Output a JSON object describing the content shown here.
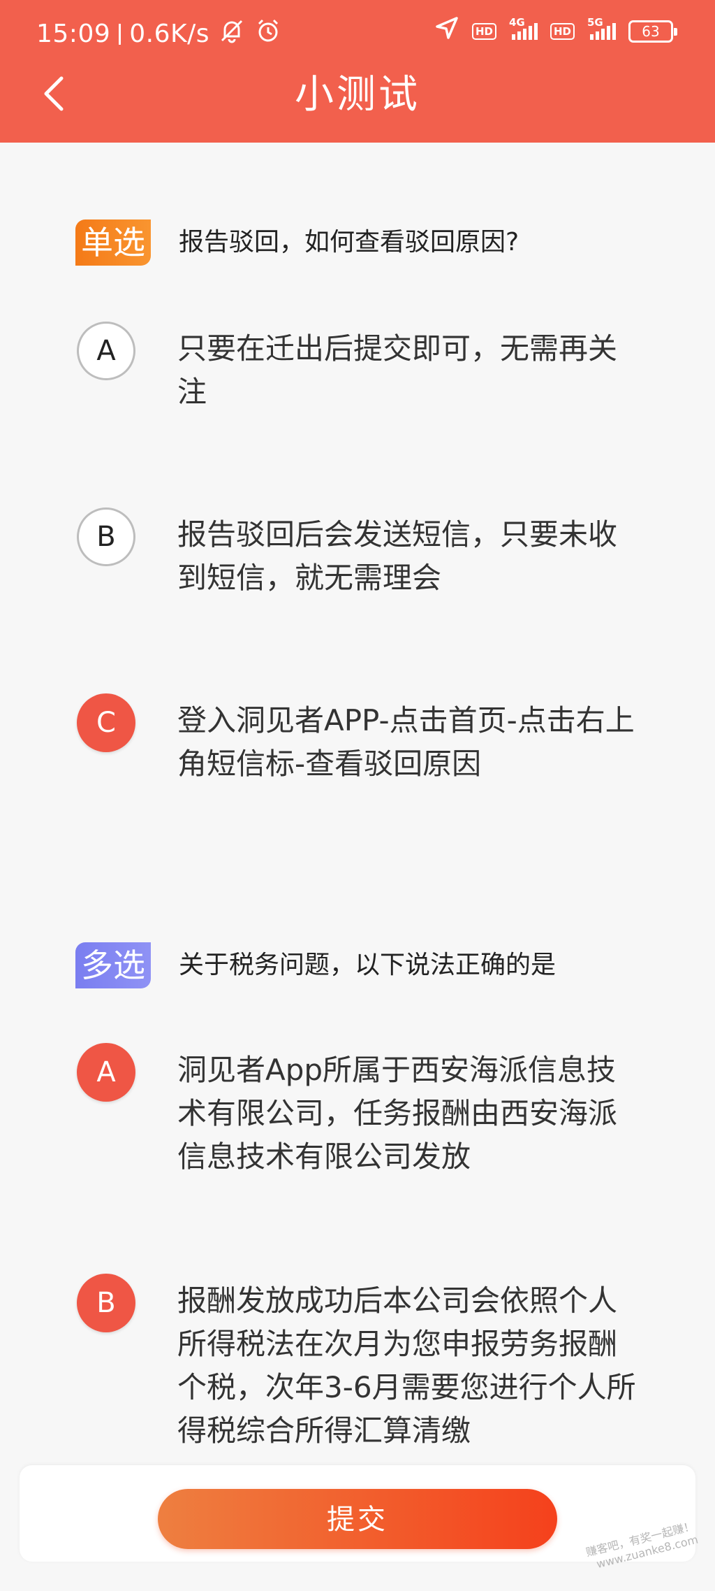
{
  "status_bar": {
    "time": "15:09",
    "speed": "0.6K/s",
    "hd_label": "HD",
    "net1": "4G",
    "net2": "5G",
    "battery": "63"
  },
  "header": {
    "title": "小测试"
  },
  "questions": [
    {
      "tag": "单选",
      "text": "报告驳回，如何查看驳回原因?",
      "options": [
        {
          "letter": "A",
          "text": "只要在迁出后提交即可，无需再关注"
        },
        {
          "letter": "B",
          "text": "报告驳回后会发送短信，只要未收到短信，就无需理会"
        },
        {
          "letter": "C",
          "text": "登入洞见者APP-点击首页-点击右上角短信标-查看驳回原因"
        }
      ]
    },
    {
      "tag": "多选",
      "text": "关于税务问题，以下说法正确的是",
      "options": [
        {
          "letter": "A",
          "text": "洞见者App所属于西安海派信息技术有限公司，任务报酬由西安海派信息技术有限公司发放"
        },
        {
          "letter": "B",
          "text": "报酬发放成功后本公司会依照个人所得税法在次月为您申报劳务报酬个税，次年3-6月需要您进行个人所得税综合所得汇算清缴"
        }
      ]
    }
  ],
  "footer": {
    "submit_label": "提交"
  },
  "watermark": {
    "line1": "赚客吧，有奖一起赚！",
    "line2": "www.zuanke8.com"
  },
  "colors": {
    "header": "#f2604d",
    "selected": "#ef5645",
    "tag_single": "#f47a17",
    "tag_multi": "#7a7ef0"
  }
}
